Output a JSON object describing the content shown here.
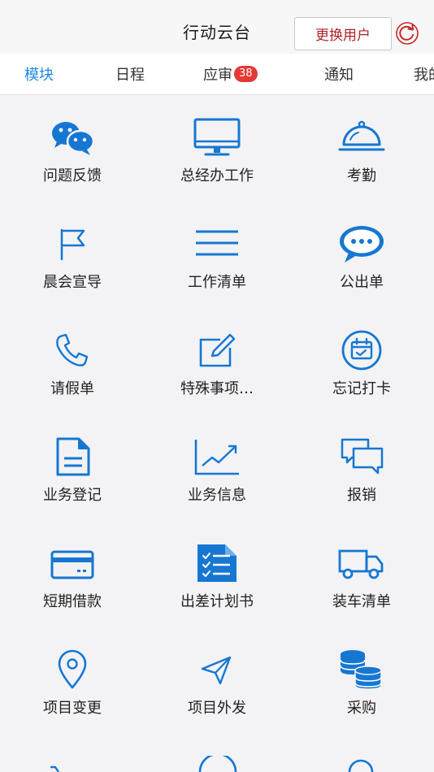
{
  "header": {
    "title": "行动云台",
    "switch_user_label": "更换用户"
  },
  "tabs": [
    {
      "label": "模块",
      "active": true
    },
    {
      "label": "日程"
    },
    {
      "label": "应审",
      "badge": "38"
    },
    {
      "label": "通知"
    },
    {
      "label": "我的"
    }
  ],
  "modules": [
    {
      "label": "问题反馈",
      "icon": "wechat-chat-icon"
    },
    {
      "label": "总经办工作",
      "icon": "monitor-icon"
    },
    {
      "label": "考勤",
      "icon": "service-bell-icon"
    },
    {
      "label": "晨会宣导",
      "icon": "flag-icon"
    },
    {
      "label": "工作清单",
      "icon": "list-lines-icon"
    },
    {
      "label": "公出单",
      "icon": "chat-bubble-icon"
    },
    {
      "label": "请假单",
      "icon": "phone-icon"
    },
    {
      "label": "特殊事项…",
      "icon": "edit-icon"
    },
    {
      "label": "忘记打卡",
      "icon": "calendar-check-icon"
    },
    {
      "label": "业务登记",
      "icon": "document-icon"
    },
    {
      "label": "业务信息",
      "icon": "trend-chart-icon"
    },
    {
      "label": "报销",
      "icon": "messages-icon"
    },
    {
      "label": "短期借款",
      "icon": "credit-card-icon"
    },
    {
      "label": "出差计划书",
      "icon": "checklist-icon"
    },
    {
      "label": "装车清单",
      "icon": "truck-icon"
    },
    {
      "label": "项目变更",
      "icon": "location-pin-icon"
    },
    {
      "label": "项目外发",
      "icon": "send-icon"
    },
    {
      "label": "采购",
      "icon": "coins-icon"
    }
  ],
  "colors": {
    "accent": "#1e88e5",
    "icon": "#1677d2",
    "switch_user_text": "#b0232a",
    "badge": "#e53935"
  }
}
